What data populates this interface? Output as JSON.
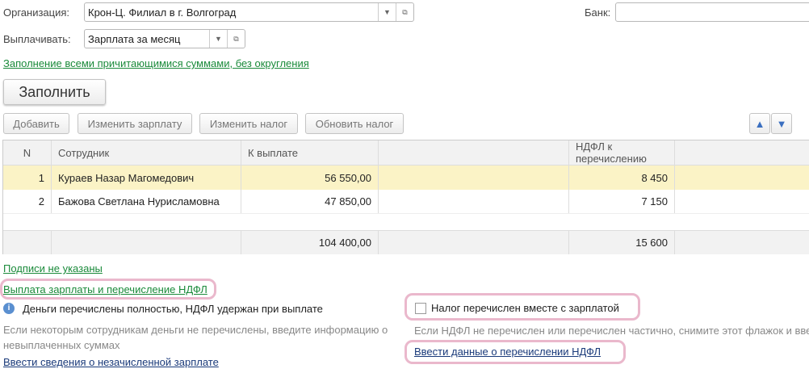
{
  "org": {
    "label": "Организация:",
    "value": "Крон-Ц. Филиал в г. Волгоград"
  },
  "bank": {
    "label": "Банк:",
    "value": ""
  },
  "pay": {
    "label": "Выплачивать:",
    "value": "Зарплата за месяц"
  },
  "fill_mode_link": "Заполнение всеми причитающимися суммами, без округления",
  "fill_button": "Заполнить",
  "toolbar": {
    "add": "Добавить",
    "change_salary": "Изменить зарплату",
    "change_tax": "Изменить налог",
    "update_tax": "Обновить налог"
  },
  "table": {
    "headers": [
      "N",
      "Сотрудник",
      "К выплате",
      "",
      "НДФЛ к перечислению"
    ],
    "rows": [
      {
        "n": "1",
        "employee": "Кураев Назар Магомедович",
        "amount": "56 550,00",
        "ndfl": "8 450"
      },
      {
        "n": "2",
        "employee": "Бажова Светлана Нурисламовна",
        "amount": "47 850,00",
        "ndfl": "7 150"
      }
    ],
    "totals": {
      "amount": "104 400,00",
      "ndfl": "15 600"
    }
  },
  "signatures_link": "Подписи не указаны",
  "payout_link": "Выплата зарплаты и перечисление НДФЛ",
  "info_text": "Деньги перечислены  полностью, НДФЛ удержан при выплате",
  "hint_left": "Если некоторым сотрудникам деньги не перечислены, введите информацию о невыплаченных суммах",
  "unpaid_link": "Ввести сведения о незачисленной зарплате",
  "tax_checkbox": {
    "label": "Налог перечислен вместе с зарплатой",
    "checked": false
  },
  "hint_right": "Если НДФЛ не перечислен или перечислен частично, снимите этот флажок и вве",
  "ndfl_link": "Ввести данные о перечислении НДФЛ"
}
